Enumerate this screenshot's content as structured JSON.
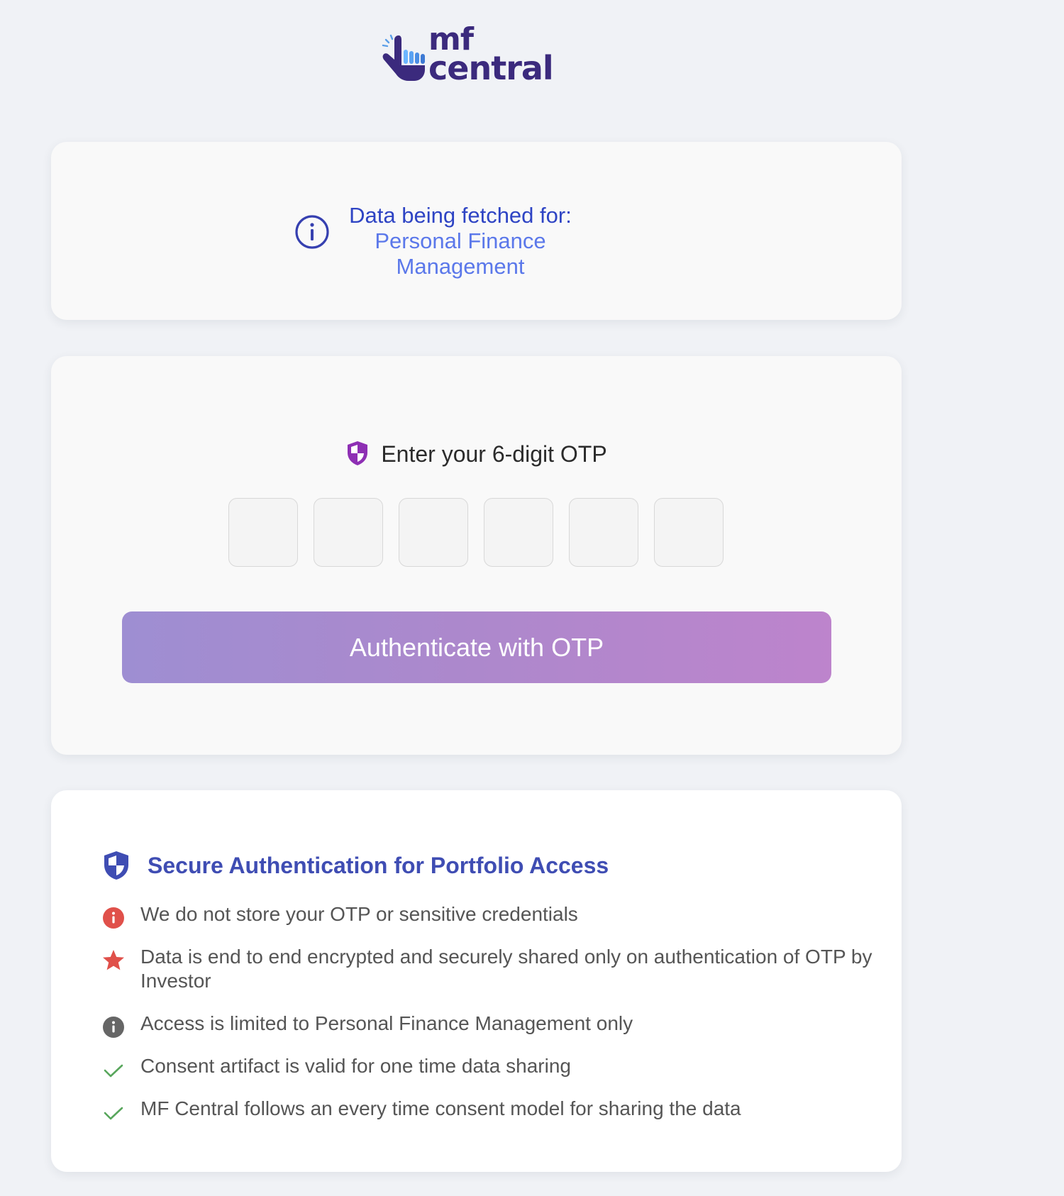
{
  "brand": {
    "name_line1": "mf",
    "name_line2": "central"
  },
  "fetch_card": {
    "label": "Data being fetched for:",
    "purpose": "Personal Finance Management"
  },
  "otp_card": {
    "title": "Enter your 6-digit OTP",
    "digits": [
      "",
      "",
      "",
      "",
      "",
      ""
    ],
    "button_label": "Authenticate with OTP"
  },
  "secure_card": {
    "title": "Secure Authentication for Portfolio Access",
    "items": [
      {
        "icon": "info-circle-red-icon",
        "text": "We do not store your OTP or sensitive credentials"
      },
      {
        "icon": "star-red-icon",
        "text": "Data is end to end encrypted and securely shared only on authentication of OTP by Investor"
      },
      {
        "icon": "info-circle-gray-icon",
        "text": "Access is limited to Personal Finance Management only"
      },
      {
        "icon": "check-green-icon",
        "text": "Consent artifact is valid for one time data sharing"
      },
      {
        "icon": "check-green-icon",
        "text": "MF Central follows an every time consent model for sharing the data"
      }
    ]
  },
  "colors": {
    "page_background": "#f0f2f6",
    "brand_purple": "#3b2a7d",
    "accent_blue": "#2e44c4",
    "light_blue": "#5b78ea",
    "button_gradient_start": "#9e8ed2",
    "button_gradient_end": "#bd84cc",
    "secure_title": "#3f4db3",
    "danger_red": "#e0504a",
    "success_green": "#58a65c",
    "neutral_gray": "#666666"
  }
}
